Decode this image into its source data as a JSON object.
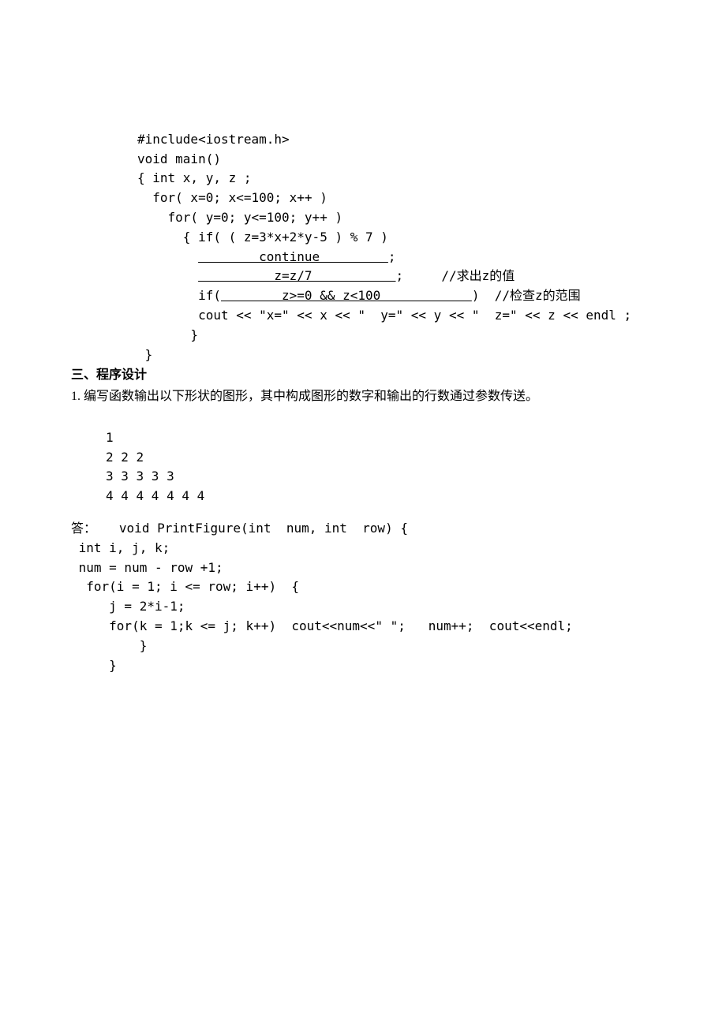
{
  "code": {
    "l1": "#include<iostream.h>",
    "l2": "void main()",
    "l3": "{ int x, y, z ;",
    "l4": "  for( x=0; x<=100; x++ )",
    "l5": "    for( y=0; y<=100; y++ )",
    "l6": "      { if( ( z=3*x+2*y-5 ) % 7 )",
    "l7a": "        ",
    "l7b": "        continue         ",
    "l7c": ";",
    "l8a": "        ",
    "l8b": "          z=z/7           ",
    "l8c": ";     //求出z的值",
    "l9a": "        if(",
    "l9b": "        z>=0 && z<100            ",
    "l9c": ")  //检查z的范围",
    "l10": "        cout << \"x=\" << x << \"  y=\" << y << \"  z=\" << z << endl ;",
    "l11": "       }",
    "l12": " }"
  },
  "section": {
    "heading": "三、程序设计"
  },
  "question1": {
    "text": "1. 编写函数输出以下形状的图形，其中构成图形的数字和输出的行数通过参数传送。",
    "pattern": {
      "r1": "1",
      "r2": "2 2 2",
      "r3": "3 3 3 3 3",
      "r4": "4 4 4 4 4 4 4"
    }
  },
  "answer": {
    "label": "答：",
    "l1": "   void PrintFigure(int  num, int  row) {",
    "l2": " int i, j, k;",
    "l3": " num = num - row +1;",
    "l4": "  for(i = 1; i <= row; i++)  {",
    "l5": "     j = 2*i-1;",
    "l6": "     for(k = 1;k <= j; k++)  cout<<num<<\" \";   num++;  cout<<endl;",
    "l7": "         }",
    "l8": "     }"
  }
}
